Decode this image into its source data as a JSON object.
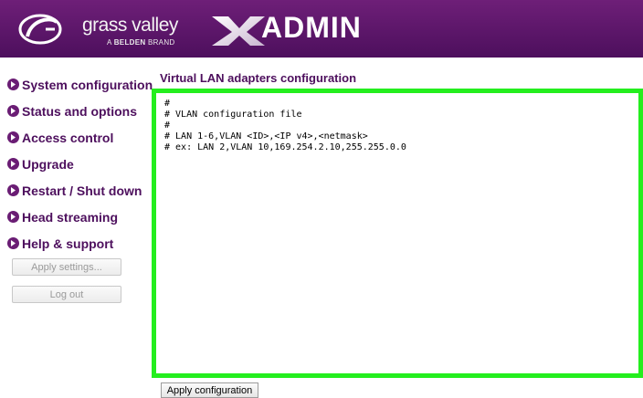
{
  "header": {
    "brand_name": "grass valley",
    "brand_sub_prefix": "A",
    "brand_sub_bold": "BELDEN",
    "brand_sub_suffix": "BRAND",
    "product_name": "ADMIN",
    "colors": {
      "header_bg": "#5a1468",
      "accent": "#4d0f5d",
      "highlight_border": "#24ee1e"
    }
  },
  "sidebar": {
    "items": [
      {
        "label": "System configuration"
      },
      {
        "label": "Status and options"
      },
      {
        "label": "Access control"
      },
      {
        "label": "Upgrade"
      },
      {
        "label": "Restart / Shut down"
      },
      {
        "label": "Head streaming"
      },
      {
        "label": "Help & support"
      }
    ],
    "apply_settings_label": "Apply settings...",
    "logout_label": "Log out"
  },
  "main": {
    "title": "Virtual LAN adapters configuration",
    "config_text": "#\n# VLAN configuration file\n#\n# LAN 1-6,VLAN <ID>,<IP v4>,<netmask>\n# ex: LAN 2,VLAN 10,169.254.2.10,255.255.0.0",
    "apply_button_label": "Apply configuration"
  }
}
